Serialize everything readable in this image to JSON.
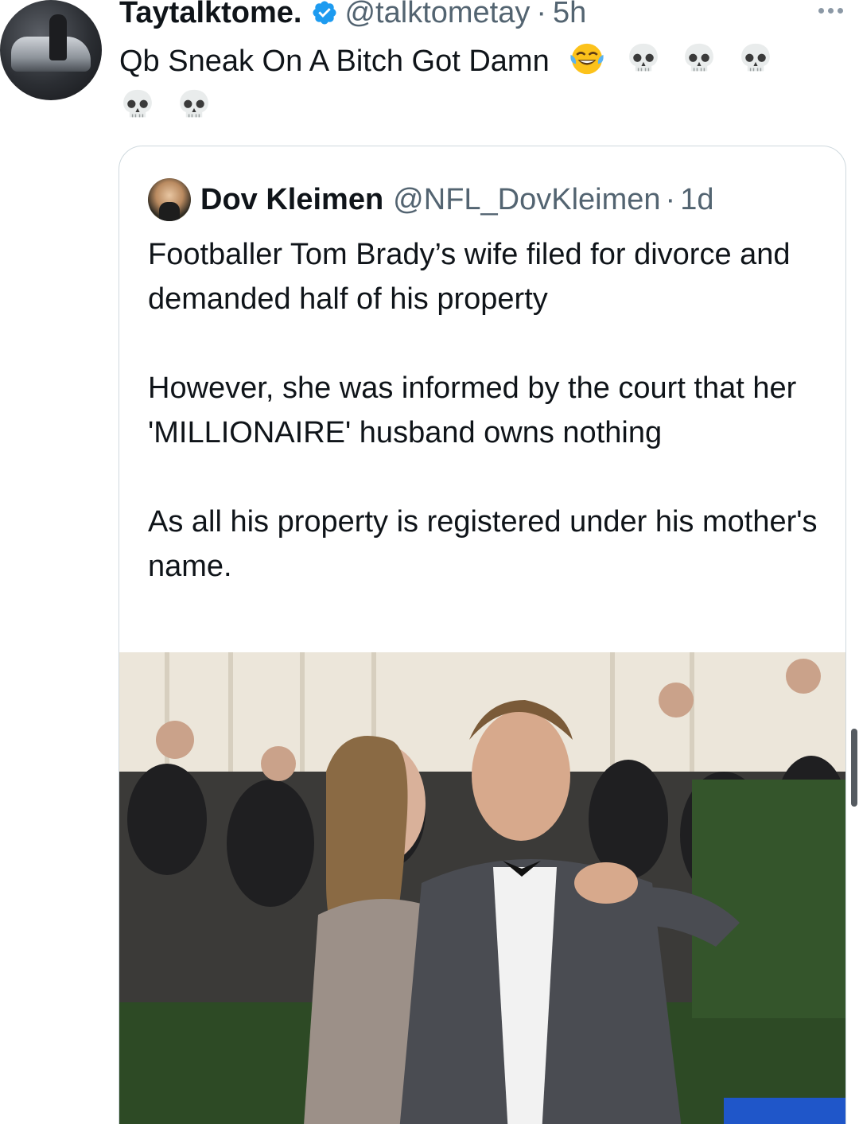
{
  "author": {
    "display_name": "Taytalktome.",
    "handle": "@talktometay",
    "separator": "·",
    "time": "5h",
    "verified": true
  },
  "tweet": {
    "text": "Qb Sneak On A Bitch Got Damn",
    "emojis": [
      "tears-of-joy-emoji",
      "skull-emoji",
      "skull-emoji",
      "skull-emoji",
      "skull-emoji",
      "skull-emoji"
    ]
  },
  "quoted_tweet": {
    "display_name": "Dov Kleimen",
    "handle": "@NFL_DovKleimen",
    "separator": "·",
    "time": "1d",
    "paragraphs": [
      "Footballer Tom Brady’s wife filed for divorce and demanded half of his property",
      "However, she was informed by the court that her 'MILLIONAIRE' husband owns nothing",
      "As all his property is registered under his mother's name."
    ]
  },
  "colors": {
    "verified_blue": "#1d9bf0",
    "secondary_text": "#536471",
    "border": "#cfd9de"
  }
}
